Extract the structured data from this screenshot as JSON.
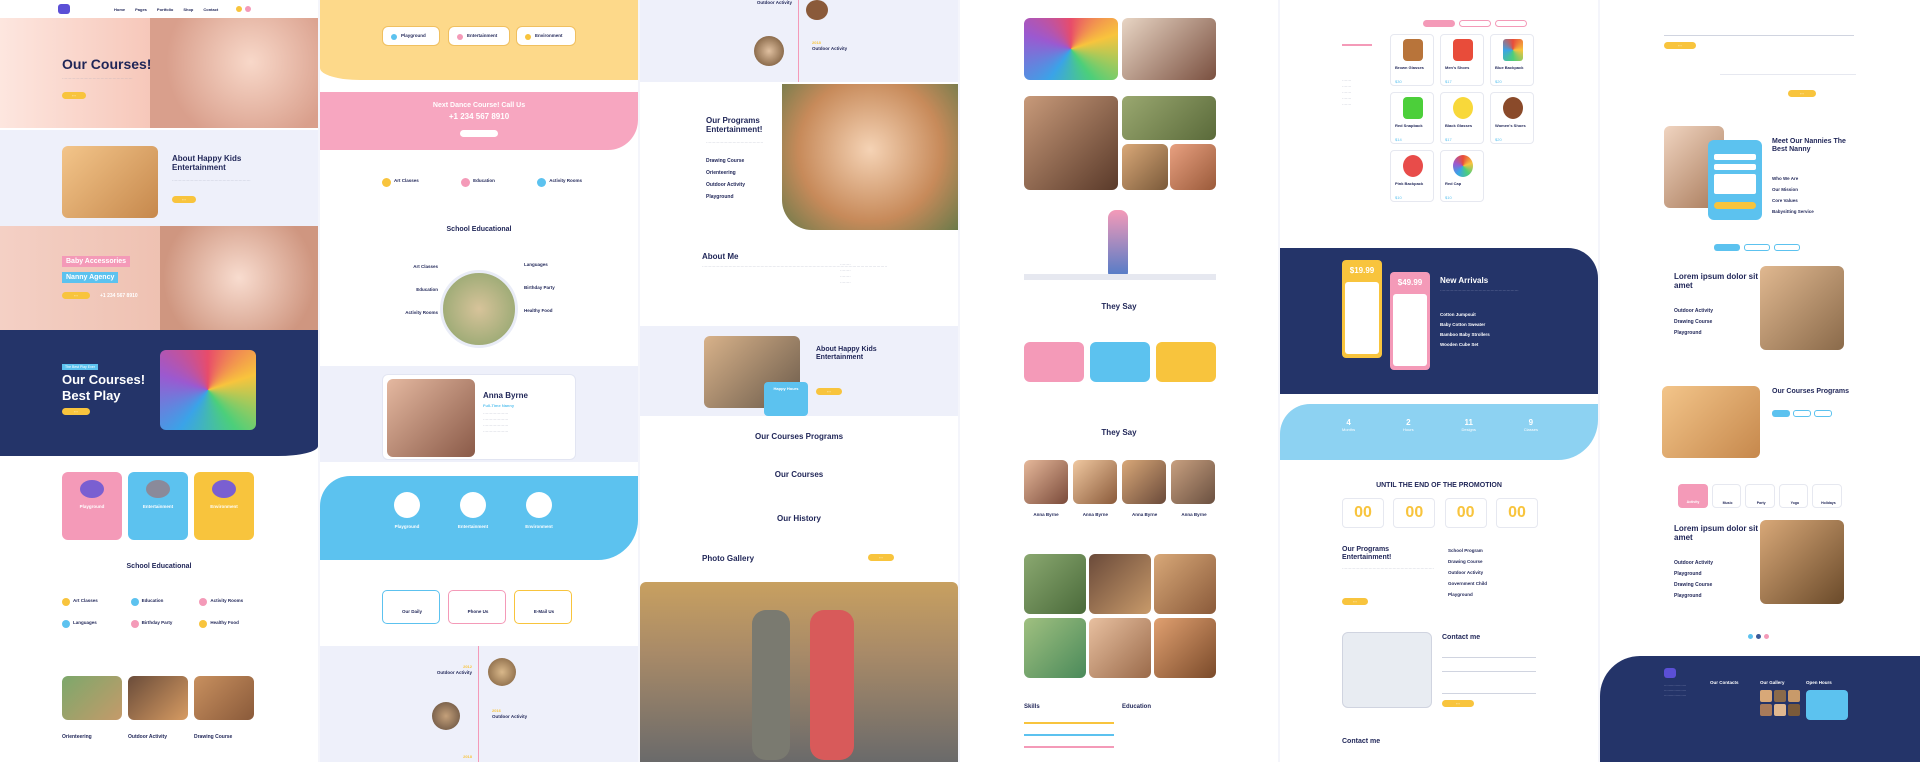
{
  "col1": {
    "nav": [
      "Home",
      "Pages",
      "Portfolio",
      "Shop",
      "Contact"
    ],
    "hero_title": "Our Courses!",
    "about_title": "About Happy Kids Entertainment",
    "baby_tag1": "Baby Accessories",
    "baby_tag2": "Nanny Agency",
    "phone": "+1 234 567 8910",
    "best_play_tag": "The Best Play Ever",
    "best_play_title1": "Our Courses!",
    "best_play_title2": "Best Play",
    "cards": [
      "Playground",
      "Entertainment",
      "Environment"
    ],
    "school_title": "School Educational",
    "features": [
      "Art Classes",
      "Education",
      "Activity Rooms",
      "Languages",
      "Birthday Party",
      "Healthy Food"
    ],
    "gallery": [
      "Orienteering",
      "Outdoor Activity",
      "Drawing Course"
    ]
  },
  "col2": {
    "tabs": [
      "Playground",
      "Entertainment",
      "Environment"
    ],
    "cta_line1": "Next Dance Course! Call Us",
    "cta_line2": "+1 234 567 8910",
    "row_items": [
      "Art Classes",
      "Education",
      "Activity Rooms"
    ],
    "school_title": "School Educational",
    "left_labels": [
      "Art Classes",
      "Education",
      "Activity Rooms"
    ],
    "right_labels": [
      "Languages",
      "Birthday Party",
      "Healthy Food"
    ],
    "profile_name": "Anna Byrne",
    "profile_role": "Full-Time Nanny",
    "blue_cards": [
      "Playground",
      "Entertainment",
      "Environment"
    ],
    "contact_boxes": [
      "Our Daily",
      "Phone Us",
      "E-Mail Us"
    ],
    "timeline": [
      {
        "year": "2012",
        "label": "Outdoor Activity"
      },
      {
        "year": "2016",
        "label": "Outdoor Activity"
      },
      {
        "year": "2018",
        "label": ""
      }
    ]
  },
  "col3": {
    "timeline_top": "Outdoor Activity",
    "timeline_year": "2018",
    "timeline_label": "Outdoor Activity",
    "programs_title": "Our Programs Entertainment!",
    "program_list": [
      "Drawing Course",
      "Orienteering",
      "Outdoor Activity",
      "Playground"
    ],
    "about_me": "About Me",
    "about_kids": "About Happy Kids Entertainment",
    "happy_hours": "Happy Hours",
    "courses_programs": "Our Courses Programs",
    "our_courses": "Our Courses",
    "our_history": "Our History",
    "photo_gallery": "Photo Gallery"
  },
  "col4": {
    "they_say": "They Say",
    "they_say2": "They Say",
    "team": [
      "Anna Byrne",
      "Anna Byrne",
      "Anna Byrne",
      "Anna Byrne"
    ],
    "skills": "Skills",
    "education": "Education"
  },
  "col5": {
    "products": [
      {
        "name": "Brown Glasses",
        "price": "$30"
      },
      {
        "name": "Men's Shoes",
        "price": "$17"
      },
      {
        "name": "Blue Backpack",
        "price": "$20"
      },
      {
        "name": "Red Snapback",
        "price": "$14"
      },
      {
        "name": "Black Glasses",
        "price": "$17"
      },
      {
        "name": "Women's Shoes",
        "price": "$20"
      },
      {
        "name": "Pink Backpack",
        "price": "$10"
      },
      {
        "name": "Red Cap",
        "price": "$10"
      }
    ],
    "price1": "$19.99",
    "price2": "$49.99",
    "new_arrivals": "New Arrivals",
    "arrivals_list": [
      "Cotton Jumpsuit",
      "Baby Cotton Sweater",
      "Bamboo Baby Strollers",
      "Wooden Cube Set"
    ],
    "stats": [
      {
        "n": "4",
        "l": "Months"
      },
      {
        "n": "2",
        "l": "Hours"
      },
      {
        "n": "11",
        "l": "Designs"
      },
      {
        "n": "9",
        "l": "Classes"
      }
    ],
    "promo_title": "UNTIL THE END OF THE PROMOTION",
    "countdown": [
      "00",
      "00",
      "00",
      "00"
    ],
    "programs_title": "Our Programs Entertainment!",
    "program_links": [
      "School Program",
      "Drawing Course",
      "Outdoor Activity",
      "Government Child",
      "Playground"
    ],
    "contact_title": "Contact me",
    "contact_title2": "Contact me"
  },
  "col6": {
    "nannies_title": "Meet Our Nannies The Best Nanny",
    "nannies_list": [
      "Who We Are",
      "Our Mission",
      "Core Values",
      "Babysitting Service"
    ],
    "lorem_title": "Lorem ipsum dolor sit amet",
    "lorem_list": [
      "Outdoor Activity",
      "Drawing Course",
      "Playground"
    ],
    "courses_title": "Our Courses Programs",
    "icon_tabs": [
      "Activity",
      "Music",
      "Party",
      "Yoga",
      "Holidays"
    ],
    "lorem_title2": "Lorem ipsum dolor sit amet",
    "lorem_list2": [
      "Outdoor Activity",
      "Playground",
      "Drawing Course",
      "Playground"
    ],
    "footer_heads": [
      "Our Contacts",
      "Our Gallery",
      "Open Hours"
    ]
  }
}
